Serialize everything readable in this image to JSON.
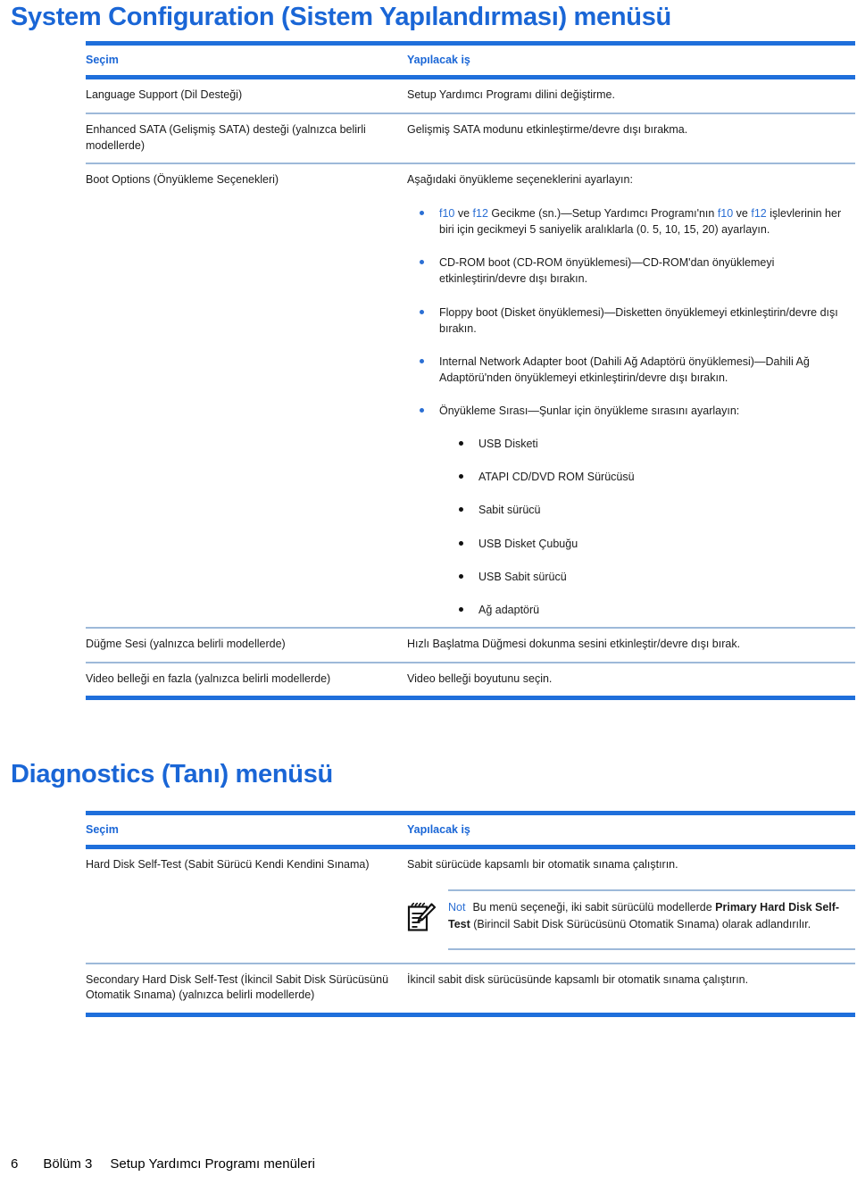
{
  "sections": [
    {
      "heading": "System Configuration (Sistem Yapılandırması) menüsü",
      "table": {
        "headers": {
          "left": "Seçim",
          "right": "Yapılacak iş"
        },
        "rows": [
          {
            "left": "Language Support (Dil Desteği)",
            "right": "Setup Yardımcı Programı dilini değiştirme."
          },
          {
            "left": "Enhanced SATA (Gelişmiş SATA) desteği (yalnızca belirli modellerde)",
            "right": "Gelişmiş SATA modunu etkinleştirme/devre dışı bırakma."
          },
          {
            "left": "Boot Options (Önyükleme Seçenekleri)",
            "right": "Aşağıdaki önyükleme seçeneklerini ayarlayın:"
          },
          {
            "left": "Düğme Sesi (yalnızca belirli modellerde)",
            "right": "Hızlı Başlatma Düğmesi dokunma sesini etkinleştir/devre dışı bırak."
          },
          {
            "left": "Video belleği en fazla (yalnızca belirli modellerde)",
            "right": "Video belleği boyutunu seçin."
          }
        ],
        "boot_bullets": [
          {
            "parts": [
              {
                "text": "f10",
                "style": "key"
              },
              {
                "text": " ve ",
                "style": "plain"
              },
              {
                "text": "f12",
                "style": "key"
              },
              {
                "text": " Gecikme (sn.)—Setup Yardımcı Programı'nın ",
                "style": "plain"
              },
              {
                "text": "f10",
                "style": "key"
              },
              {
                "text": " ve ",
                "style": "plain"
              },
              {
                "text": "f12",
                "style": "key"
              },
              {
                "text": " işlevlerinin her biri için gecikmeyi 5 saniyelik aralıklarla (0. 5, 10, 15, 20) ayarlayın.",
                "style": "plain"
              }
            ]
          },
          {
            "parts": [
              {
                "text": "CD-ROM boot (CD-ROM önyüklemesi)—CD-ROM'dan önyüklemeyi etkinleştirin/devre dışı bırakın.",
                "style": "plain"
              }
            ]
          },
          {
            "parts": [
              {
                "text": "Floppy boot (Disket önyüklemesi)—Disketten önyüklemeyi etkinleştirin/devre dışı bırakın.",
                "style": "plain"
              }
            ]
          },
          {
            "parts": [
              {
                "text": "Internal Network Adapter boot (Dahili Ağ Adaptörü önyüklemesi)—Dahili Ağ Adaptörü'nden önyüklemeyi etkinleştirin/devre dışı bırakın.",
                "style": "plain"
              }
            ]
          },
          {
            "parts": [
              {
                "text": "Önyükleme Sırası—Şunlar için önyükleme sırasını ayarlayın:",
                "style": "plain"
              }
            ],
            "sub_items": [
              "USB Disketi",
              "ATAPI CD/DVD ROM Sürücüsü",
              "Sabit sürücü",
              "USB Disket Çubuğu",
              "USB Sabit sürücü",
              "Ağ adaptörü"
            ]
          }
        ]
      }
    },
    {
      "heading": "Diagnostics (Tanı) menüsü",
      "table": {
        "headers": {
          "left": "Seçim",
          "right": "Yapılacak iş"
        },
        "rows": [
          {
            "left": "Hard Disk Self-Test (Sabit Sürücü Kendi Kendini Sınama)",
            "right": "Sabit sürücüde kapsamlı bir otomatik sınama çalıştırın."
          },
          {
            "left": "Secondary Hard Disk Self-Test (İkincil Sabit Disk Sürücüsünü Otomatik Sınama) (yalnızca belirli modellerde)",
            "right": "İkincil sabit disk sürücüsünde kapsamlı bir otomatik sınama çalıştırın."
          }
        ],
        "note": {
          "icon": "note-pencil-icon",
          "label": "Not",
          "parts": [
            {
              "text": "Bu menü seçeneği, iki sabit sürücülü modellerde ",
              "style": "plain"
            },
            {
              "text": "Primary Hard Disk Self-Test",
              "style": "bold"
            },
            {
              "text": " (Birincil Sabit Disk Sürücüsünü Otomatik Sınama) olarak adlandırılır.",
              "style": "plain"
            }
          ]
        }
      }
    }
  ],
  "footer": {
    "page_number": "6",
    "chapter": "Bölüm 3",
    "title": "Setup Yardımcı Programı menüleri"
  },
  "colors": {
    "heading_blue": "#1a66d6",
    "rule_blue": "#1f6fdb",
    "rule_light": "#9db9d9",
    "key_blue": "#2b6fd4",
    "text": "#1b1b1b"
  }
}
